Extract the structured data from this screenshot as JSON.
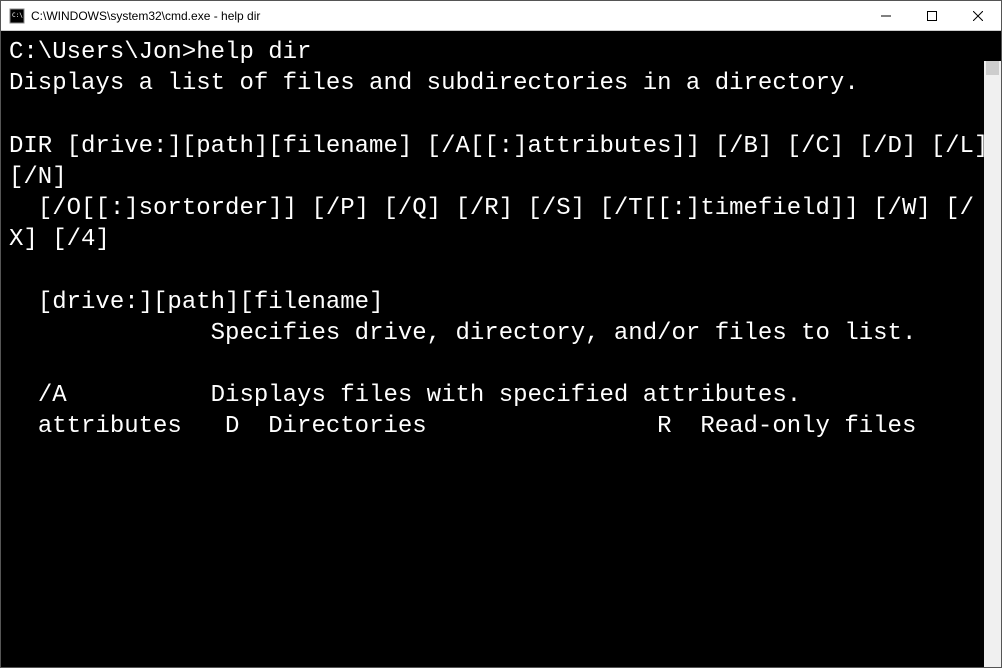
{
  "titlebar": {
    "title": "C:\\WINDOWS\\system32\\cmd.exe - help  dir"
  },
  "terminal": {
    "prompt": "C:\\Users\\Jon>",
    "command": "help dir",
    "line_description": "Displays a list of files and subdirectories in a directory.",
    "line_syntax1": "DIR [drive:][path][filename] [/A[[:]attributes]] [/B] [/C] [/D] [/L] [/N]",
    "line_syntax2": "  [/O[[:]sortorder]] [/P] [/Q] [/R] [/S] [/T[[:]timefield]] [/W] [/X] [/4]",
    "line_param_header": "  [drive:][path][filename]",
    "line_param_desc": "              Specifies drive, directory, and/or files to list.",
    "line_a_switch": "  /A          Displays files with specified attributes.",
    "line_attrs": "  attributes   D  Directories                R  Read-only files"
  }
}
